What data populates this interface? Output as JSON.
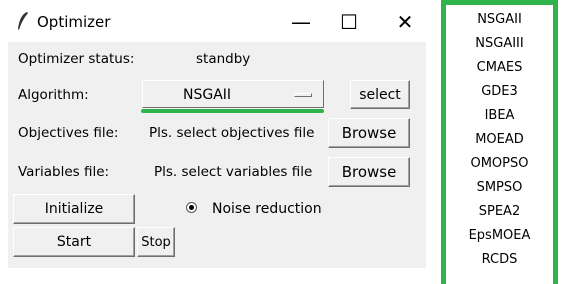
{
  "window": {
    "title": "Optimizer",
    "minimize_glyph": "—",
    "maximize_glyph": "☐",
    "close_glyph": "✕"
  },
  "status": {
    "label": "Optimizer status:",
    "value": "standby"
  },
  "algorithm": {
    "label": "Algorithm:",
    "selected": "NSGAII",
    "select_label": "select"
  },
  "objectives": {
    "label": "Objectives file:",
    "value": "Pls. select objectives file",
    "browse_label": "Browse"
  },
  "variables": {
    "label": "Variables file:",
    "value": "Pls. select variables file",
    "browse_label": "Browse"
  },
  "actions": {
    "initialize_label": "Initialize",
    "start_label": "Start",
    "stop_label": "Stop"
  },
  "noise_reduction": {
    "label": "Noise reduction",
    "checked": true
  },
  "algorithm_options": [
    "NSGAII",
    "NSGAIII",
    "CMAES",
    "GDE3",
    "IBEA",
    "MOEAD",
    "OMOPSO",
    "SMPSO",
    "SPEA2",
    "EpsMOEA",
    "RCDS"
  ],
  "colors": {
    "highlight_green": "#2fb34a",
    "panel_gray": "#f0f0f0"
  }
}
